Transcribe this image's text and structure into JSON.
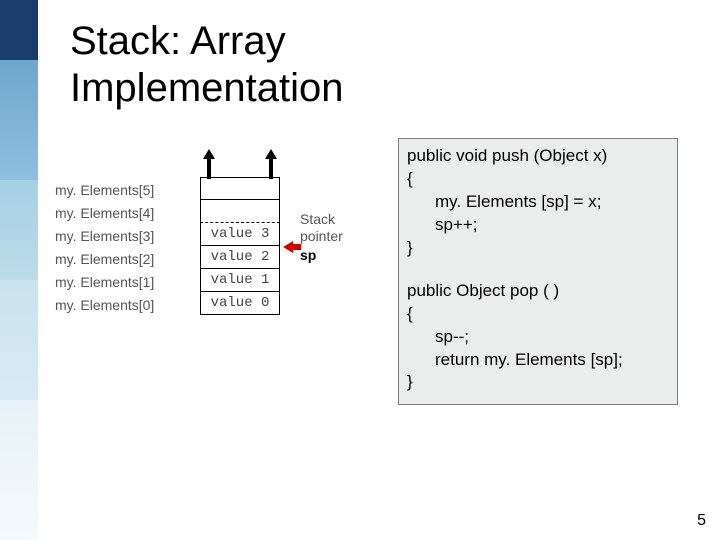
{
  "title": "Stack: Array\nImplementation",
  "diagram": {
    "labels": [
      "my. Elements[5]",
      "my. Elements[4]",
      "my. Elements[3]",
      "my. Elements[2]",
      "my. Elements[1]",
      "my. Elements[0]"
    ],
    "cells": [
      "",
      "",
      "value 3",
      "value 2",
      "value 1",
      "value 0"
    ],
    "pointer_label1": "Stack",
    "pointer_label2": "pointer",
    "pointer_name": "sp"
  },
  "code": {
    "push": {
      "sig": "public void push (Object x)",
      "open": "{",
      "l1": "my. Elements [sp] = x;",
      "l2": "sp++;",
      "close": "}"
    },
    "pop": {
      "sig": "public Object pop ( )",
      "open": "{",
      "l1": "sp--;",
      "l2": "return my. Elements [sp];",
      "close": "}"
    }
  },
  "page_number": "5"
}
